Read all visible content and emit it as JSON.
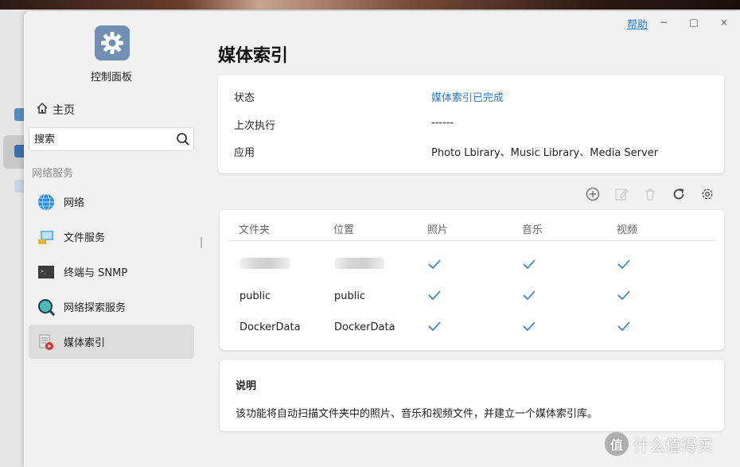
{
  "window": {
    "help_label": "帮助",
    "minimize_glyph": "−",
    "maximize_glyph": "□",
    "close_glyph": "×"
  },
  "sidebar": {
    "app_title": "控制面板",
    "home_label": "主页",
    "search_placeholder": "搜索",
    "section_label": "网络服务",
    "items": [
      {
        "label": "网络",
        "icon": "globe-icon"
      },
      {
        "label": "文件服务",
        "icon": "file-service-icon"
      },
      {
        "label": "终端与 SNMP",
        "icon": "terminal-icon"
      },
      {
        "label": "网络探索服务",
        "icon": "discovery-icon"
      },
      {
        "label": "媒体索引",
        "icon": "media-index-icon",
        "active": true
      }
    ]
  },
  "main": {
    "title": "媒体索引",
    "info": [
      {
        "label": "状态",
        "value": "媒体索引已完成",
        "value_color": "#2a7bc9"
      },
      {
        "label": "上次执行",
        "value": "------"
      },
      {
        "label": "应用",
        "value": "Photo Lbirary、Music Library、Media Server"
      }
    ],
    "toolbar": [
      "add-icon",
      "edit-icon",
      "delete-icon",
      "refresh-icon",
      "settings-icon"
    ],
    "table": {
      "headers": [
        "文件夹",
        "位置",
        "照片",
        "音乐",
        "视频"
      ],
      "rows": [
        {
          "folder": "",
          "location": "",
          "photo": true,
          "music": true,
          "video": true
        },
        {
          "folder": "public",
          "location": "public",
          "photo": true,
          "music": true,
          "video": true
        },
        {
          "folder": "DockerData",
          "location": "DockerData",
          "photo": true,
          "music": true,
          "video": true
        }
      ]
    },
    "note": {
      "title": "说明",
      "text": "该功能将自动扫描文件夹中的照片、音乐和视频文件，并建立一个媒体索引库。"
    }
  },
  "watermark": {
    "logo_glyph": "值",
    "text": "什么值得买"
  },
  "colors": {
    "accent": "#2a7bc9",
    "check": "#2a7bc9",
    "active_bg": "#dcdcdc"
  }
}
